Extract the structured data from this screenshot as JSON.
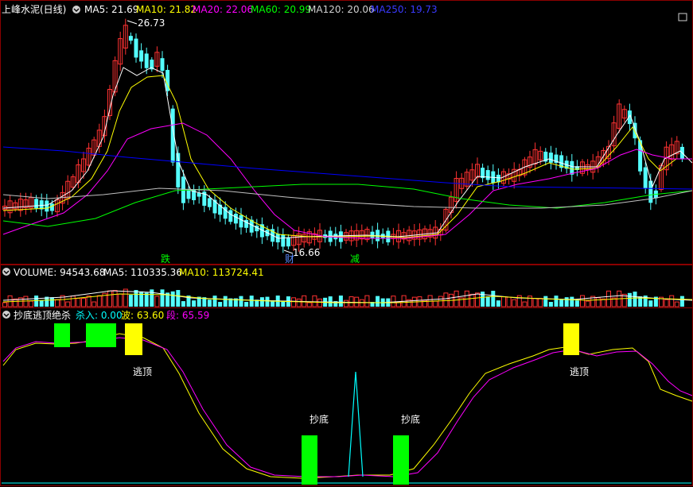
{
  "colors": {
    "background": "#000000",
    "border": "#8b0000",
    "up": "#ff3232",
    "down": "#54ffff",
    "ma5": "#ffffff",
    "ma10": "#ffff00",
    "ma20": "#ff00ff",
    "ma60": "#00ff00",
    "ma120": "#c0c0c0",
    "ma250": "#0000ff",
    "bull_label": "#00ff00",
    "bear_label": "#ff3232",
    "fall_label": "#ffff00",
    "buy_text": "#00ffff",
    "wave_text": "#ffff00",
    "seg_text": "#ff00ff",
    "green_block": "#00ff00",
    "yellow_block": "#ffff00",
    "cyan_spike": "#00ffff"
  },
  "main": {
    "stock": "上峰水泥(日线)",
    "ma5": "MA5: 21.69",
    "ma10": "MA10: 21.82",
    "ma20": "MA20: 22.06",
    "ma60": "MA60: 20.99",
    "ma120": "MA120: 20.06",
    "ma250": "MA250: 19.73",
    "high_label": "26.73",
    "low_label": "16.66",
    "tags": [
      "跌",
      "财",
      "减"
    ]
  },
  "volume": {
    "title": "VOLUME: 94543.68",
    "ma5": "MA5: 110335.36",
    "ma10": "MA10: 113724.41"
  },
  "indicator": {
    "name": "抄底逃顶绝杀",
    "buy": "杀入: 0.00",
    "wave": "波: 63.60",
    "seg": "段: 65.59",
    "top_label": "逃顶",
    "bottom_label": "抄底"
  },
  "chart_data": [
    {
      "type": "candlestick",
      "title": "上峰水泥(日线)",
      "ylim": [
        15.5,
        27.6
      ],
      "annotations": {
        "high": 26.73,
        "low": 16.66
      },
      "series": [
        {
          "name": "MA5",
          "values": [
            21.69
          ]
        },
        {
          "name": "MA10",
          "values": [
            21.82
          ]
        },
        {
          "name": "MA20",
          "values": [
            22.06
          ]
        },
        {
          "name": "MA60",
          "values": [
            20.99
          ]
        },
        {
          "name": "MA120",
          "values": [
            20.06
          ]
        },
        {
          "name": "MA250",
          "values": [
            19.73
          ]
        }
      ]
    },
    {
      "type": "bar",
      "title": "VOLUME",
      "series": [
        {
          "name": "VOLUME",
          "values": [
            94543.68
          ]
        },
        {
          "name": "MA5",
          "values": [
            110335.36
          ]
        },
        {
          "name": "MA10",
          "values": [
            113724.41
          ]
        }
      ]
    },
    {
      "type": "line",
      "title": "抄底逃顶绝杀",
      "series": [
        {
          "name": "杀入",
          "values": [
            0.0
          ]
        },
        {
          "name": "波",
          "values": [
            63.6
          ]
        },
        {
          "name": "段",
          "values": [
            65.59
          ]
        }
      ]
    }
  ]
}
